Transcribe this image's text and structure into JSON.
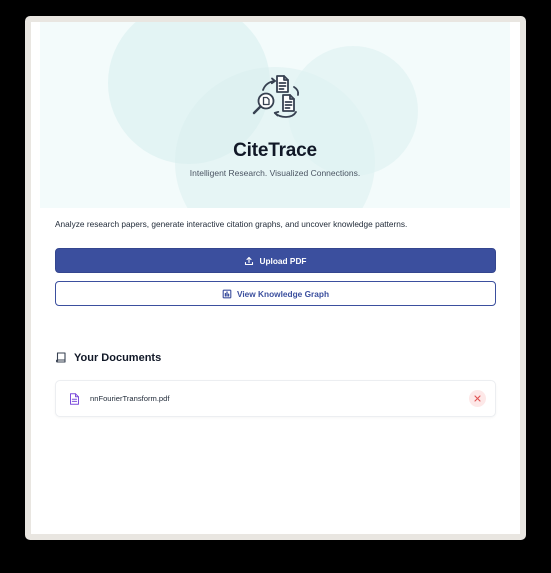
{
  "hero": {
    "title": "CiteTrace",
    "subtitle": "Intelligent Research. Visualized Connections.",
    "logo_icon": "document-search-cycle-icon"
  },
  "description": "Analyze research papers, generate interactive citation graphs, and uncover knowledge patterns.",
  "actions": {
    "upload_label": "Upload PDF",
    "upload_icon": "upload-icon",
    "graph_label": "View Knowledge Graph",
    "graph_icon": "chart-icon"
  },
  "documents": {
    "heading": "Your Documents",
    "heading_icon": "book-icon",
    "items": [
      {
        "name": "nnFourierTransform.pdf",
        "icon": "file-text-icon",
        "remove_icon": "close-icon"
      }
    ]
  },
  "colors": {
    "primary": "#3b4f9e",
    "hero_background": "#f3fbfb",
    "file_icon": "#7c4ddb",
    "remove_bg": "#fde8e8",
    "remove_x": "#e05252"
  }
}
